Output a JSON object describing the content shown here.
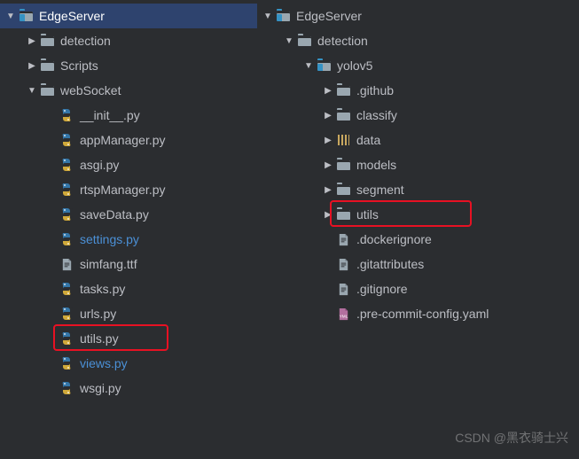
{
  "left": {
    "root": "EdgeServer",
    "items": [
      {
        "label": "detection",
        "type": "folder",
        "depth": 1,
        "arrow": "right"
      },
      {
        "label": "Scripts",
        "type": "folder",
        "depth": 1,
        "arrow": "right"
      },
      {
        "label": "webSocket",
        "type": "folder",
        "depth": 1,
        "arrow": "down"
      },
      {
        "label": "__init__.py",
        "type": "py",
        "depth": 2,
        "arrow": "none"
      },
      {
        "label": "appManager.py",
        "type": "py",
        "depth": 2,
        "arrow": "none"
      },
      {
        "label": "asgi.py",
        "type": "py",
        "depth": 2,
        "arrow": "none"
      },
      {
        "label": "rtspManager.py",
        "type": "py",
        "depth": 2,
        "arrow": "none"
      },
      {
        "label": "saveData.py",
        "type": "py",
        "depth": 2,
        "arrow": "none"
      },
      {
        "label": "settings.py",
        "type": "py",
        "depth": 2,
        "arrow": "none",
        "accent": true
      },
      {
        "label": "simfang.ttf",
        "type": "file",
        "depth": 2,
        "arrow": "none"
      },
      {
        "label": "tasks.py",
        "type": "py",
        "depth": 2,
        "arrow": "none"
      },
      {
        "label": "urls.py",
        "type": "py",
        "depth": 2,
        "arrow": "none"
      },
      {
        "label": "utils.py",
        "type": "py",
        "depth": 2,
        "arrow": "none",
        "highlight": true
      },
      {
        "label": "views.py",
        "type": "py",
        "depth": 2,
        "arrow": "none",
        "accent": true
      },
      {
        "label": "wsgi.py",
        "type": "py",
        "depth": 2,
        "arrow": "none"
      }
    ]
  },
  "right": {
    "root": "EdgeServer",
    "items": [
      {
        "label": "detection",
        "type": "folder",
        "depth": 1,
        "arrow": "down"
      },
      {
        "label": "yolov5",
        "type": "folder-special",
        "depth": 2,
        "arrow": "down"
      },
      {
        "label": ".github",
        "type": "folder",
        "depth": 3,
        "arrow": "right"
      },
      {
        "label": "classify",
        "type": "folder",
        "depth": 3,
        "arrow": "right"
      },
      {
        "label": "data",
        "type": "data-folder",
        "depth": 3,
        "arrow": "right"
      },
      {
        "label": "models",
        "type": "folder",
        "depth": 3,
        "arrow": "right"
      },
      {
        "label": "segment",
        "type": "folder",
        "depth": 3,
        "arrow": "right"
      },
      {
        "label": "utils",
        "type": "folder",
        "depth": 3,
        "arrow": "right",
        "highlight": true
      },
      {
        "label": ".dockerignore",
        "type": "file",
        "depth": 3,
        "arrow": "none"
      },
      {
        "label": ".gitattributes",
        "type": "file",
        "depth": 3,
        "arrow": "none"
      },
      {
        "label": ".gitignore",
        "type": "file",
        "depth": 3,
        "arrow": "none"
      },
      {
        "label": ".pre-commit-config.yaml",
        "type": "yml",
        "depth": 3,
        "arrow": "none"
      }
    ]
  },
  "watermark": "CSDN @黑衣骑士兴"
}
